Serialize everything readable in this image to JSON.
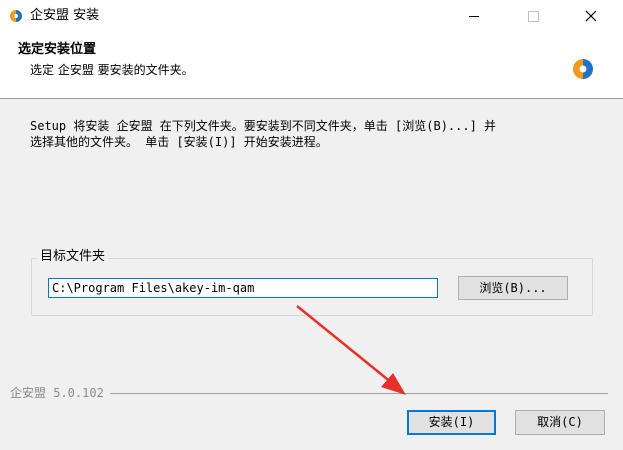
{
  "window": {
    "title": "企安盟 安装",
    "controls": {
      "minimize": "—",
      "maximize": "☐",
      "close": "✕"
    }
  },
  "header": {
    "title": "选定安装位置",
    "subtitle": "选定 企安盟 要安装的文件夹。"
  },
  "description": {
    "line1": "Setup 将安装 企安盟 在下列文件夹。要安装到不同文件夹，单击 [浏览(B)...] 并",
    "line2": "选择其他的文件夹。 单击 [安装(I)] 开始安装进程。"
  },
  "destination": {
    "group_label": "目标文件夹",
    "path": "C:\\Program Files\\akey-im-qam",
    "browse_label": "浏览(B)..."
  },
  "footer": {
    "version": "企安盟 5.0.102",
    "install_label": "安装(I)",
    "cancel_label": "取消(C)"
  },
  "colors": {
    "accent": "#0078d7",
    "annotation_arrow": "#e8302a",
    "logo_orange": "#f39a1e",
    "logo_blue": "#1f74c8"
  }
}
